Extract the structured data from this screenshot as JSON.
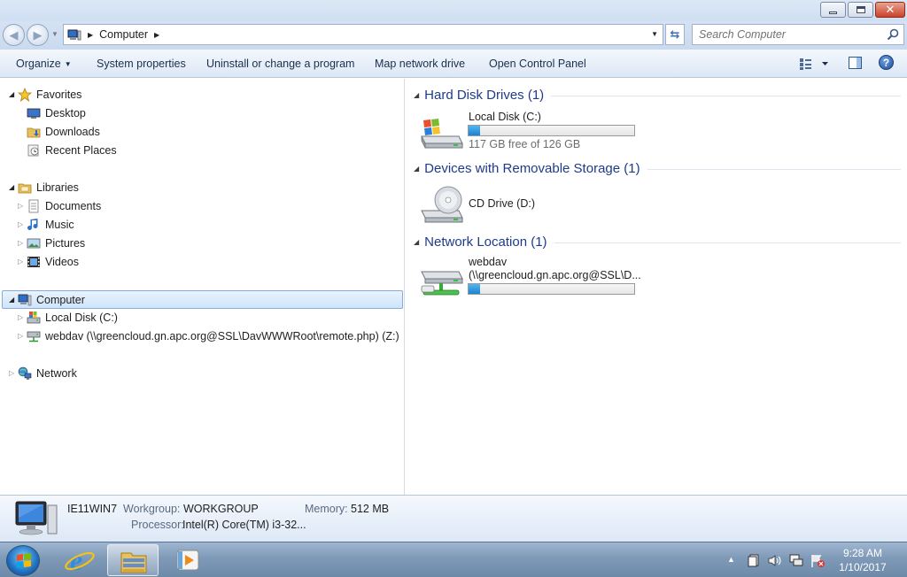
{
  "window": {
    "controls": {
      "minimize": "minimize",
      "maximize": "maximize",
      "close": "close"
    }
  },
  "address": {
    "path": [
      "Computer"
    ],
    "search_placeholder": "Search Computer"
  },
  "commands": {
    "organize": "Organize",
    "system_properties": "System properties",
    "uninstall": "Uninstall or change a program",
    "map_drive": "Map network drive",
    "open_control_panel": "Open Control Panel"
  },
  "nav": {
    "favorites": "Favorites",
    "desktop": "Desktop",
    "downloads": "Downloads",
    "recent_places": "Recent Places",
    "libraries": "Libraries",
    "documents": "Documents",
    "music": "Music",
    "pictures": "Pictures",
    "videos": "Videos",
    "computer": "Computer",
    "local_disk": "Local Disk (C:)",
    "webdav": "webdav (\\\\greencloud.gn.apc.org@SSL\\DavWWWRoot\\remote.php) (Z:)",
    "network": "Network"
  },
  "content": {
    "groups": [
      {
        "title": "Hard Disk Drives (1)",
        "items": [
          {
            "name": "Local Disk (C:)",
            "free_text": "117 GB free of 126 GB",
            "used_fraction": 0.07
          }
        ]
      },
      {
        "title": "Devices with Removable Storage (1)",
        "items": [
          {
            "name": "CD Drive (D:)"
          }
        ]
      },
      {
        "title": "Network Location (1)",
        "items": [
          {
            "name": "webdav",
            "path": "(\\\\greencloud.gn.apc.org@SSL\\D...",
            "used_fraction": 0.07
          }
        ]
      }
    ]
  },
  "details": {
    "computer_name": "IE11WIN7",
    "workgroup_label": "Workgroup:",
    "workgroup": "WORKGROUP",
    "memory_label": "Memory:",
    "memory": "512 MB",
    "processor_label": "Processor:",
    "processor": "Intel(R) Core(TM) i3-32..."
  },
  "taskbar": {
    "time": "9:28 AM",
    "date": "1/10/2017"
  },
  "colors": {
    "group_title": "#1e3b8a",
    "capacity_fill": "#1b83d3",
    "selection": "#cfe4fb"
  }
}
